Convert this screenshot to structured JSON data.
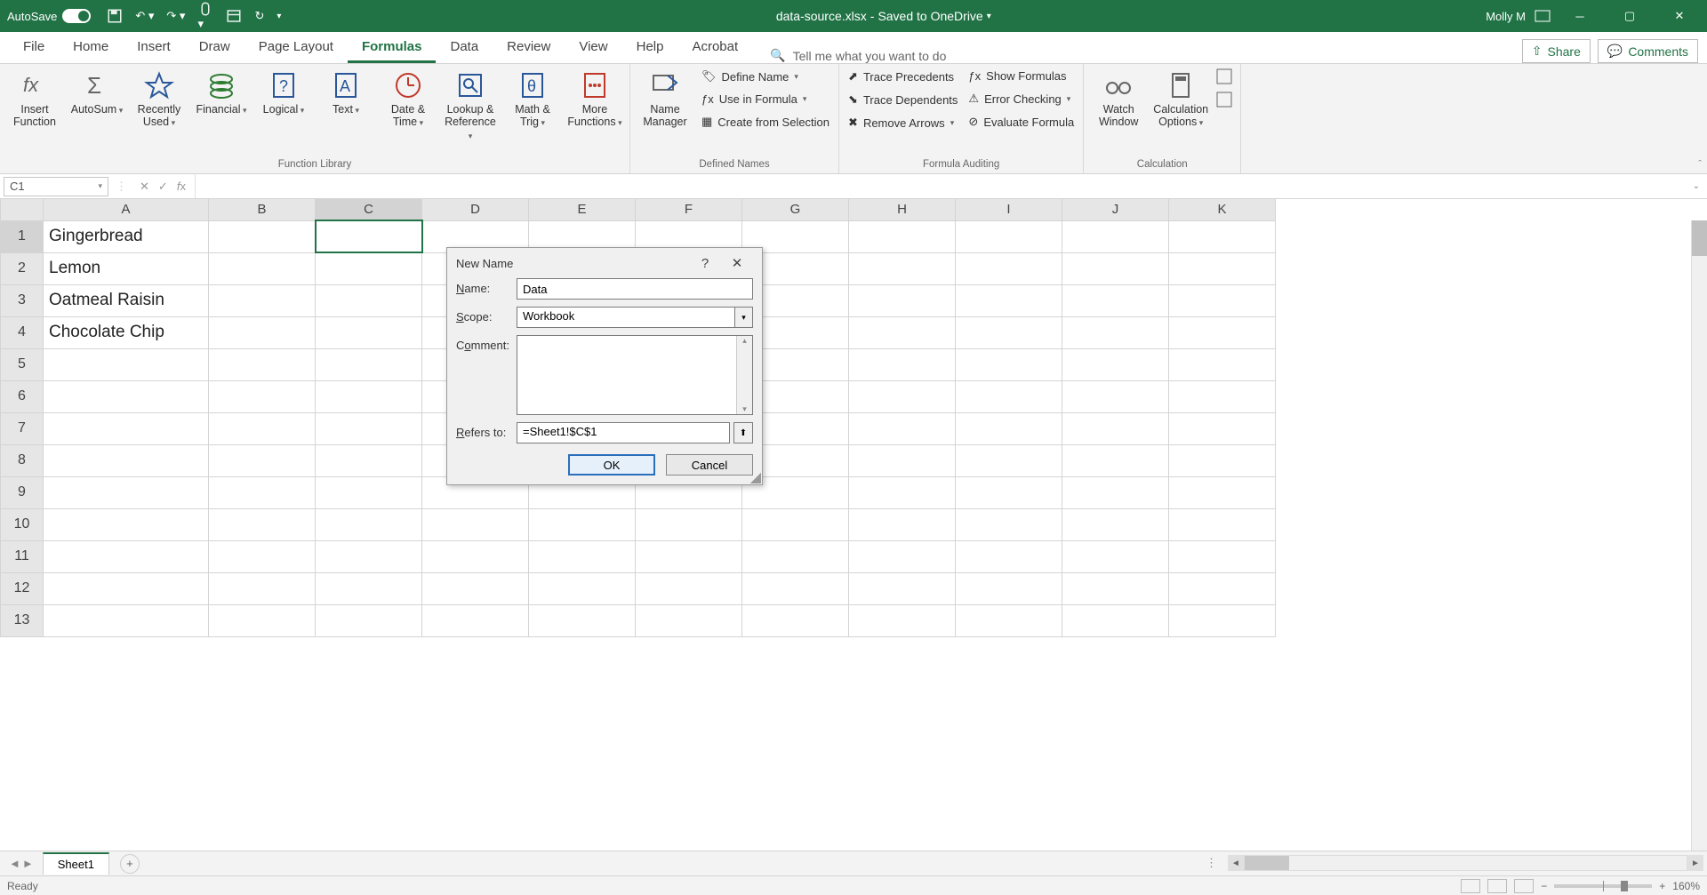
{
  "titlebar": {
    "autosave": "AutoSave",
    "autosave_state": "On",
    "filename": "data-source.xlsx",
    "saved_status": "Saved to OneDrive",
    "user": "Molly M"
  },
  "tabs": [
    "File",
    "Home",
    "Insert",
    "Draw",
    "Page Layout",
    "Formulas",
    "Data",
    "Review",
    "View",
    "Help",
    "Acrobat"
  ],
  "active_tab": "Formulas",
  "tellme": "Tell me what you want to do",
  "share": "Share",
  "comments": "Comments",
  "ribbon": {
    "group1": {
      "insert_function": "Insert\nFunction",
      "autosum": "AutoSum",
      "recent": "Recently\nUsed",
      "financial": "Financial",
      "logical": "Logical",
      "text": "Text",
      "datetime": "Date &\nTime",
      "lookup": "Lookup &\nReference",
      "mathtrig": "Math &\nTrig",
      "more": "More\nFunctions",
      "label": "Function Library"
    },
    "group2": {
      "name_manager": "Name\nManager",
      "define_name": "Define Name",
      "use_in_formula": "Use in Formula",
      "create_from_selection": "Create from Selection",
      "label": "Defined Names"
    },
    "group3": {
      "trace_precedents": "Trace Precedents",
      "trace_dependents": "Trace Dependents",
      "remove_arrows": "Remove Arrows",
      "show_formulas": "Show Formulas",
      "error_checking": "Error Checking",
      "evaluate_formula": "Evaluate Formula",
      "label": "Formula Auditing"
    },
    "group4": {
      "watch_window": "Watch\nWindow",
      "calc_options": "Calculation\nOptions",
      "label": "Calculation"
    }
  },
  "namebox": "C1",
  "columns": [
    "A",
    "B",
    "C",
    "D",
    "E",
    "F",
    "G",
    "H",
    "I",
    "J",
    "K"
  ],
  "rows": [
    1,
    2,
    3,
    4,
    5,
    6,
    7,
    8,
    9,
    10,
    11,
    12,
    13
  ],
  "cells": {
    "A1": "Gingerbread",
    "A2": "Lemon",
    "A3": "Oatmeal Raisin",
    "A4": "Chocolate Chip"
  },
  "selected_cell": "C1",
  "sheettab": "Sheet1",
  "statusbar": {
    "ready": "Ready",
    "zoom": "160%"
  },
  "dialog": {
    "title": "New Name",
    "name_label": "Name:",
    "name_value": "Data",
    "scope_label": "Scope:",
    "scope_value": "Workbook",
    "comment_label": "Comment:",
    "refers_label": "Refers to:",
    "refers_value": "=Sheet1!$C$1",
    "ok": "OK",
    "cancel": "Cancel"
  }
}
